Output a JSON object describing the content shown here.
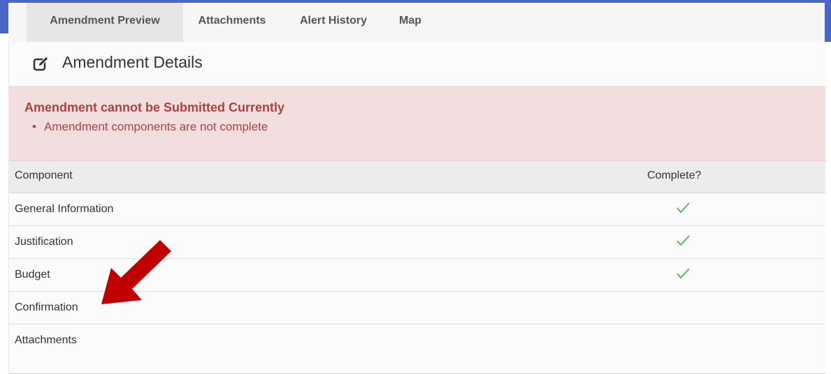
{
  "tabs": [
    {
      "label": "Amendment Preview",
      "active": true
    },
    {
      "label": "Attachments",
      "active": false
    },
    {
      "label": "Alert History",
      "active": false
    },
    {
      "label": "Map",
      "active": false
    }
  ],
  "section": {
    "title": "Amendment Details",
    "icon": "edit-icon"
  },
  "alert": {
    "title": "Amendment cannot be Submitted Currently",
    "items": [
      "Amendment components are not complete"
    ]
  },
  "table": {
    "headers": [
      "Component",
      "Complete?"
    ],
    "rows": [
      {
        "component": "General Information",
        "complete": true
      },
      {
        "component": "Justification",
        "complete": true
      },
      {
        "component": "Budget",
        "complete": true
      },
      {
        "component": "Confirmation",
        "complete": false
      },
      {
        "component": "Attachments",
        "complete": false
      }
    ]
  },
  "colors": {
    "check": "#5cb85c",
    "alert_text": "#a94442",
    "alert_bg": "#f2dede",
    "annotation_arrow": "#c00000",
    "frame": "#4a64c8"
  }
}
